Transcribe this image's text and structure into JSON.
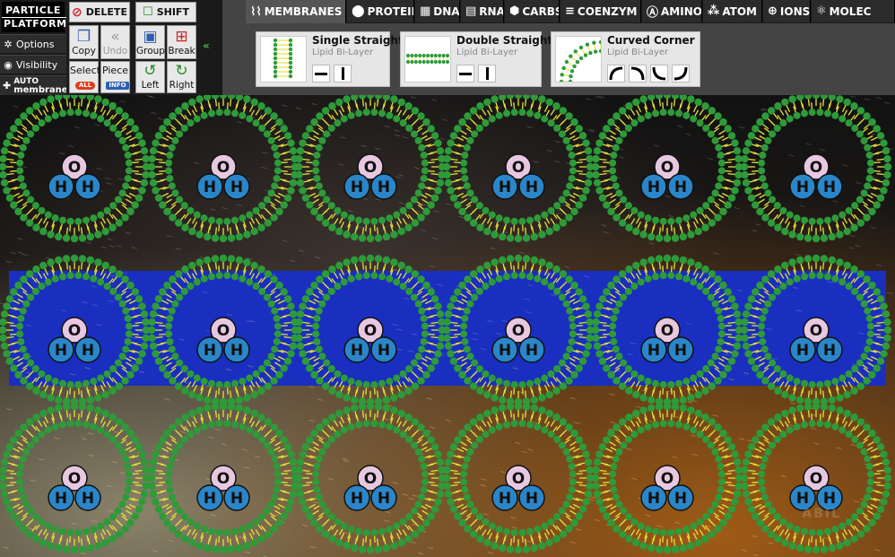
{
  "app": {
    "logo_line1": "PARTICLE",
    "logo_line2": "PLATFORM"
  },
  "sidebar": {
    "options": "Options",
    "visibility": "Visibility",
    "auto_line1": "AUTO",
    "auto_line2": "membrane"
  },
  "tools": {
    "delete": "DELETE",
    "shift": "SHIFT",
    "copy": "Copy",
    "undo": "Undo",
    "group": "Group",
    "break": "Break",
    "select": "Select",
    "select_badge": "ALL",
    "piece": "Piece",
    "piece_badge": "INFO",
    "left": "Left",
    "right": "Right"
  },
  "tabs": [
    {
      "label": "MEMBRANES",
      "icon": "membrane-icon",
      "active": true
    },
    {
      "label": "PROTEIN",
      "icon": "protein-icon",
      "active": false
    },
    {
      "label": "DNA",
      "icon": "dna-icon",
      "active": false
    },
    {
      "label": "RNA",
      "icon": "rna-icon",
      "active": false
    },
    {
      "label": "CARBS",
      "icon": "carbs-icon",
      "active": false
    },
    {
      "label": "COENZYM",
      "icon": "coenzyme-icon",
      "active": false
    },
    {
      "label": "AMINO",
      "icon": "amino-icon",
      "active": false
    },
    {
      "label": "ATOM",
      "icon": "atom-icon",
      "active": false
    },
    {
      "label": "IONS",
      "icon": "ions-icon",
      "active": false
    },
    {
      "label": "MOLEC",
      "icon": "molecule-icon",
      "active": false
    }
  ],
  "cards": [
    {
      "title": "Single Straight",
      "subtitle": "Lipid Bi-Layer"
    },
    {
      "title": "Double Straight",
      "subtitle": "Lipid Bi-Layer"
    },
    {
      "title": "Curved Corner",
      "subtitle": "Lipid Bi-Layer"
    }
  ],
  "molecule": {
    "oxygen": "O",
    "hydrogen": "H"
  },
  "watermark": "ABIL",
  "colors": {
    "lipid_head": "#2e9a3a",
    "lipid_tail": "#e8e03a",
    "water_band": "#1a2fbf",
    "oxygen": "#e8c8e0",
    "hydrogen": "#2a86c8",
    "accent_green": "#00aa00",
    "delete_red": "#cc2222"
  }
}
